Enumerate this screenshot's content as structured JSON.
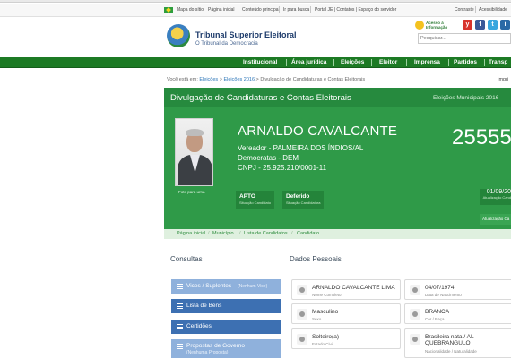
{
  "gov_bar": {
    "mapa": "Mapa do sítio",
    "inicial": "Página inicial",
    "conteudo": "Conteúdo principal",
    "busca": "Ir para busca",
    "portal": "Portal JE | Contatos | Espaço do servidor",
    "contraste": "Contraste",
    "acessibilidade": "Acessibilidade"
  },
  "header": {
    "title": "Tribunal Superior Eleitoral",
    "subtitle": "O Tribunal da Democracia",
    "acesso": "Acesso à Informação",
    "search_placeholder": "Pesquisar...",
    "social": [
      "y",
      "f",
      "t",
      "i"
    ]
  },
  "nav": {
    "items": [
      "Institucional",
      "Área jurídica",
      "Eleições",
      "Eleitor",
      "Imprensa",
      "Partidos",
      "Transp"
    ]
  },
  "breadcrumb": {
    "prefix": "Você está em:",
    "items": [
      "Eleições",
      "Eleições 2016",
      "Divulgação de Candidaturas e Contas Eleitorais"
    ],
    "print": "Impri"
  },
  "panel": {
    "title": "Divulgação de Candidaturas e Contas Eleitorais",
    "election": "Eleições Municipais 2016",
    "photo_caption": "Foto para urna",
    "candidate_name": "ARNALDO CAVALCANTE",
    "office": "Vereador - PALMEIRA DOS ÍNDIOS/AL",
    "party": "Democratas - DEM",
    "cnpj": "CNPJ - 25.925.210/0001-11",
    "number": "25555",
    "status1_value": "APTO",
    "status1_label": "Situação Candidato",
    "status2_value": "Deferido",
    "status2_label": "Situação Candidatura",
    "update_date": "01/09/20",
    "update_label": "Atualização Cand",
    "update_button": "Atualização Ca"
  },
  "subcrumb": [
    "Página inicial",
    "Município",
    "Lista de Candidatos",
    "Candidato"
  ],
  "consultas": {
    "title": "Consultas",
    "buttons": [
      {
        "label": "Vices / Suplentes",
        "extra": "(Nenhum Vice)"
      },
      {
        "label": "Lista de Bens",
        "extra": ""
      },
      {
        "label": "Certidões",
        "extra": ""
      },
      {
        "label": "Propostas de Governo",
        "extra": "(Nenhuma Proposta)"
      }
    ]
  },
  "dados": {
    "title": "Dados Pessoais",
    "fields": [
      {
        "value": "ARNALDO CAVALCANTE LIMA",
        "label": "Nome Completo",
        "icon": "user-icon"
      },
      {
        "value": "04/07/1974",
        "label": "Data de Nascimento",
        "icon": "calendar-icon"
      },
      {
        "value": "Masculino",
        "label": "Sexo",
        "icon": "gender-icon"
      },
      {
        "value": "BRANCA",
        "label": "Cor / Raça",
        "icon": "palette-icon"
      },
      {
        "value": "Solteiro(a)",
        "label": "Estado Civil",
        "icon": "ring-icon"
      },
      {
        "value": "Brasileira nata / AL-QUEBRANGULO",
        "label": "Nacionalidade / Naturalidade",
        "icon": "flag-icon"
      }
    ]
  },
  "colors": {
    "green_nav": "#1c7a24",
    "panel_green": "#2f9a48",
    "button_blue": "#3d70b2"
  }
}
